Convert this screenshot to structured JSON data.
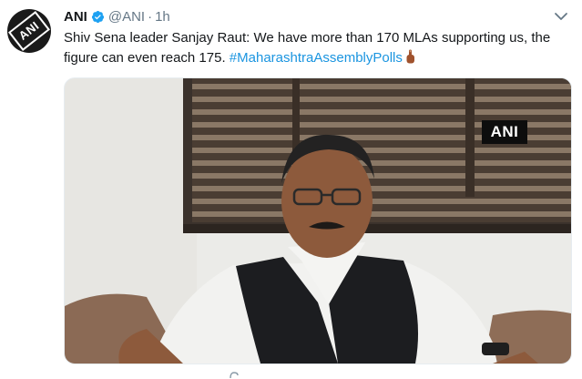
{
  "tweet": {
    "author_name": "ANI",
    "handle": "@ANI",
    "separator": "·",
    "time": "1h",
    "text_main": "Shiv Sena leader Sanjay Raut: We have more than 170 MLAs supporting us, the figure can even reach 175.",
    "hashtag": "#MaharashtraAssemblyPolls"
  },
  "avatar": {
    "logo_text": "ANI"
  },
  "media": {
    "watermark": "ANI"
  },
  "icons": {
    "verified": "verified-badge-icon",
    "caret": "chevron-down-icon",
    "emoji": "raised-index-finger-emoji"
  },
  "colors": {
    "link": "#1b95e0",
    "verified": "#1da1f2",
    "muted": "#657786",
    "text": "#14171a"
  }
}
